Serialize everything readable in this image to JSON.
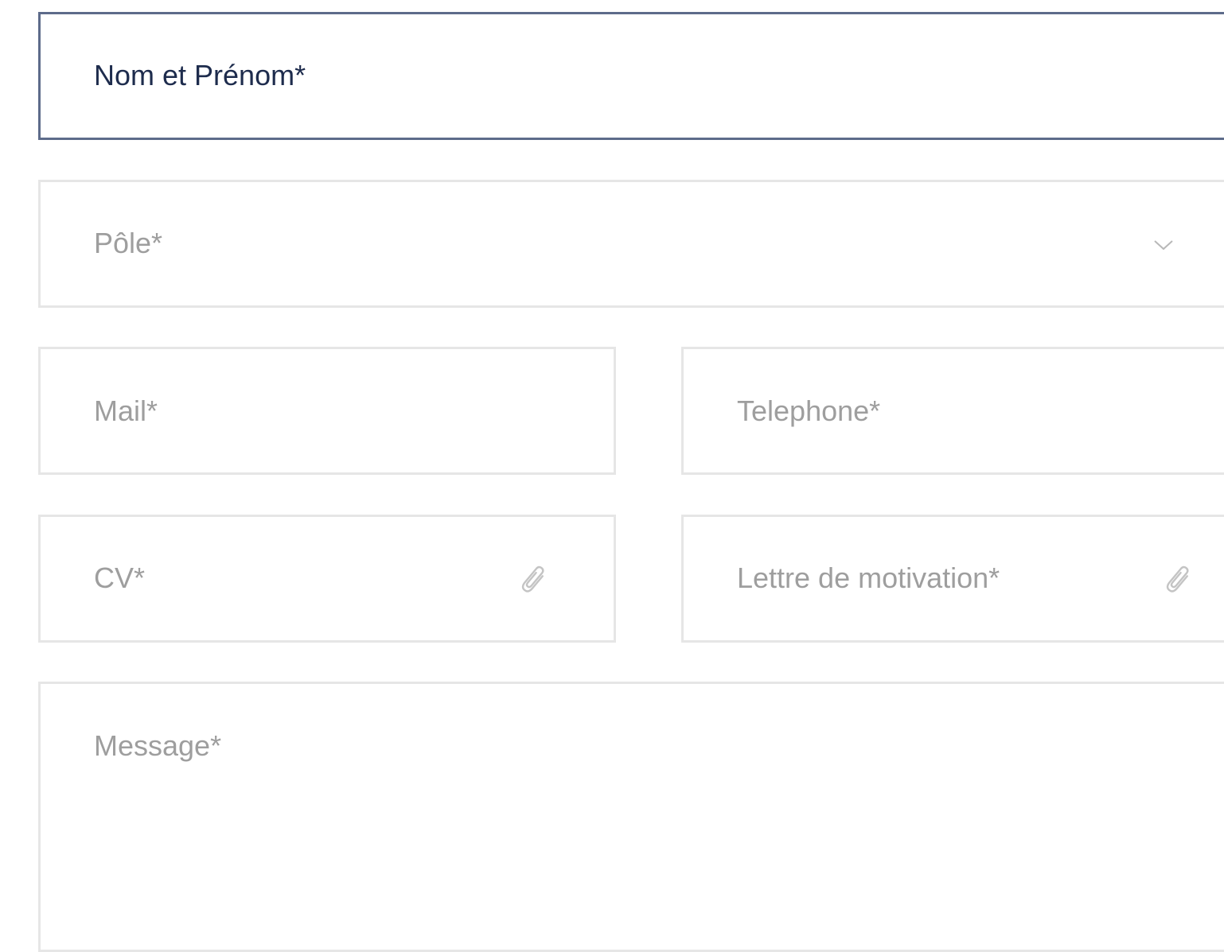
{
  "form": {
    "name_field": {
      "placeholder": "Nom et Prénom*"
    },
    "pole_select": {
      "placeholder": "Pôle*",
      "icon": "chevron-down-icon"
    },
    "mail_field": {
      "placeholder": "Mail*"
    },
    "phone_field": {
      "placeholder": "Telephone*"
    },
    "cv_upload": {
      "placeholder": "CV*",
      "icon": "paperclip-icon"
    },
    "letter_upload": {
      "placeholder": "Lettre de motivation*",
      "icon": "paperclip-icon"
    },
    "message_field": {
      "placeholder": "Message*"
    }
  },
  "colors": {
    "active_border": "#5d6b8a",
    "active_text": "#1e2c4d",
    "border": "#e6e6e6",
    "placeholder": "#9e9e9e"
  }
}
